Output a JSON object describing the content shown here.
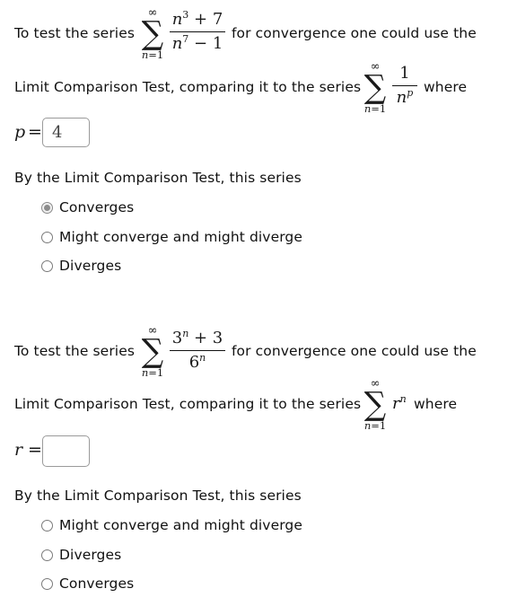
{
  "questions": [
    {
      "intro_before": "To test the series",
      "intro_after": "for convergence one could use the",
      "series": {
        "upper": "∞",
        "lower_var": "n",
        "lower_eq": "=1",
        "numerator": "n³ + 7",
        "denominator": "n⁷ − 1"
      },
      "comparison_text": "Limit Comparison Test, comparing it to the series",
      "comparison_series": {
        "upper": "∞",
        "lower_var": "n",
        "lower_eq": "=1",
        "term": "1 / n^p"
      },
      "where_label": "where",
      "variable_label": "p",
      "equals": "=",
      "answer_value": "4",
      "conclusion_prompt": "By the Limit Comparison Test, this series",
      "options": [
        {
          "label": "Converges",
          "checked": true
        },
        {
          "label": "Might converge and might diverge",
          "checked": false
        },
        {
          "label": "Diverges",
          "checked": false
        }
      ]
    },
    {
      "intro_before": "To test the series",
      "intro_after": "for convergence one could use the",
      "series": {
        "upper": "∞",
        "lower_var": "n",
        "lower_eq": "=1",
        "numerator": "3ⁿ + 3",
        "denominator": "6ⁿ"
      },
      "comparison_text": "Limit Comparison Test, comparing it to the series",
      "comparison_series": {
        "upper": "∞",
        "lower_var": "n",
        "lower_eq": "=1",
        "term": "r^n"
      },
      "where_label": "where",
      "variable_label": "r",
      "equals": "=",
      "answer_value": "",
      "conclusion_prompt": "By the Limit Comparison Test, this series",
      "options": [
        {
          "label": "Might converge and might diverge",
          "checked": false
        },
        {
          "label": "Diverges",
          "checked": false
        },
        {
          "label": "Converges",
          "checked": false
        }
      ]
    }
  ],
  "math_parts": {
    "q1_num_base": "n",
    "q1_num_exp": "3",
    "q1_num_rest": " + 7",
    "q1_den_base": "n",
    "q1_den_exp": "7",
    "q1_den_rest": " − 1",
    "q1_cmp_num": "1",
    "q1_cmp_den_base": "n",
    "q1_cmp_den_exp": "p",
    "q2_num_base": "3",
    "q2_num_exp": "n",
    "q2_num_rest": " + 3",
    "q2_den_base": "6",
    "q2_den_exp": "n",
    "q2_cmp_base": "r",
    "q2_cmp_exp": "n"
  }
}
